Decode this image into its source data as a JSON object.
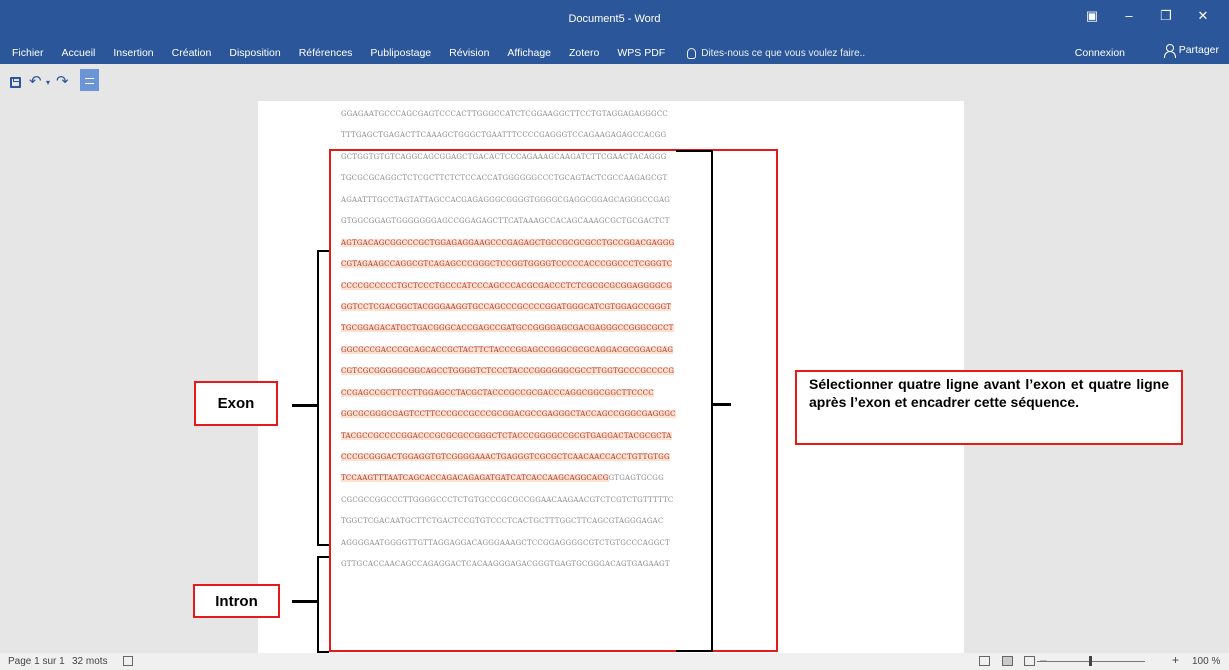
{
  "window": {
    "title": "Document5 - Word",
    "controls": [
      "ribbon-display",
      "minimize",
      "restore",
      "close"
    ]
  },
  "ribbon": {
    "tabs": [
      "Fichier",
      "Accueil",
      "Insertion",
      "Création",
      "Disposition",
      "Références",
      "Publipostage",
      "Révision",
      "Affichage",
      "Zotero",
      "WPS PDF"
    ],
    "tell_me": "Dites-nous ce que vous voulez faire..",
    "connexion": "Connexion",
    "partager": "Partager"
  },
  "quick_access": {
    "icons": [
      "save-icon",
      "undo-icon",
      "redo-icon",
      "touch-mode-icon"
    ]
  },
  "document": {
    "sequence_lines": [
      {
        "text": "GGAGAATGCCCAGCGAGTCCCACTTGGGCCATCTCGGAAGGCTTCCTGTAGGAGAGGGCC",
        "exon": false
      },
      {
        "text": "TTTGAGCTGAGACTTCAAAGCTGGGCTGAATTTCCCCGAGGGTCCAGAAGAGAGCCACGG",
        "exon": false
      },
      {
        "text": "GCTGGTGTGTCAGGCAGCGGAGCTGACACTCCCAGAAAGCAAGATCTTCGAACTACAGGG",
        "exon": false
      },
      {
        "text": "TGCGCGCAGGCTCTCGCTTCTCTCCACCATGGGGGGCCCTGCAGTACTCGCCAAGAGCGT",
        "exon": false
      },
      {
        "text": "AGAATTTGCCTAGTATTAGCCACGAGAGGGCGGGGTGGGGCGAGGCGGAGCAGGGCCGAG",
        "exon": false
      },
      {
        "text": "GTGGCGGAGTGGGGGGGAGCCGGAGAGCTTCATAAAGCCACAGCAAAGCGCTGCGACTCT",
        "exon": false
      },
      {
        "text": "AGTGACAGCGGCCCGCTGGAGAGGAAGCCCGAGAGCTGCCGCGCGCCTGCCGGACGAGGG",
        "exon": true
      },
      {
        "text": "CGTAGAAGCCAGGCGTCAGAGCCCGGGCTCCGGTGGGGTCCCCCACCCGGCCCTCGGGTC",
        "exon": true
      },
      {
        "text": "CCCCGCCCCCTGCTCCCTGCCCATCCCAGCCCACGCGACCCTCTCGCGCGCGGAGGGGCG",
        "exon": true
      },
      {
        "text": "GGTCCTCGACGGCTACGGGAAGGTGCCAGCCCGCCCCGGATGGGCATCGTGGAGCCGGGT",
        "exon": true
      },
      {
        "text": "TGCGGAGACATGCTGACGGGCACCGAGCCGATGCCGGGGAGCGACGAGGGCCGGGCGCCT",
        "exon": true
      },
      {
        "text": "GGCGCCGACCCGCAGCACCGCTACTTCTACCCGGAGCCGGGCGCGCAGGACGCGGACGAG",
        "exon": true
      },
      {
        "text": "CGTCGCGGGGGCGGCAGCCTGGGGTCTCCCTACCCGGGGGGCGCCTTGGTGCCCGCCCCG",
        "exon": true
      },
      {
        "text": "CCGAGCCGCTTCCTTGGAGCCTACGCTACCCGCCGCGACCCAGGCGGCGGCTTCCCC",
        "exon": true
      },
      {
        "text": "GGCGCGGGCGAGTCCTTCCCGCCGCCCGCGGACGCCGAGGGCTACCAGCCGGGCGAGGGC",
        "exon": true
      },
      {
        "text": "TACGCCGCCCCGGACCCGCGCGCCGGGCTCTACCCGGGGCCGCGTGAGGACTACGCGCTA",
        "exon": true
      },
      {
        "text": "CCCGCGGGACTGGAGGTGTCGGGGAAACTGAGGGTCGCGCTCAACAACCACCTGTTGTGG",
        "exon": true
      },
      {
        "text": "TCCAAGTTTAATCAGCACCAGACAGAGATGATCATCACCAAGCAGGCACGGTGAGTGCGG",
        "exon": true,
        "exon_part": "TCCAAGTTTAATCAGCACCAGACAGAGATGATCATCACCAAGCAGGCACG",
        "intron_part": "GTGAGTGCGG"
      },
      {
        "text": "CGCGCCGGCCCTTGGGGCCCTCTGTGCCCGCGCCGGAACAAGAACGTCTCGTCTGTTTTTC",
        "exon": false
      },
      {
        "text": "TGGCTCGACAATGCTTCTGACTCCGTGTCCCTCACTGCTTTGGCTTCAGCGTAGGGAGAC",
        "exon": false
      },
      {
        "text": "AGGGGAATGGGGTTGTTAGGAGGACAGGGAAAGCTCCGGAGGGGCGTCTGTGCCCAGGCT",
        "exon": false
      },
      {
        "text": "GTTGCACCAACAGCCAGAGGACTCACAAGGGAGACGGGTGAGTGCGGGACAGTGAGAAGT",
        "exon": false
      }
    ]
  },
  "annotations": {
    "exon_label": "Exon",
    "intron_label": "Intron",
    "instruction": "Sélectionner quatre ligne  avant l’exon et quatre ligne après l’exon et encadrer cette séquence."
  },
  "colors": {
    "ribbon_blue": "#2b579a",
    "annotation_red": "#e31b1b",
    "exon_text": "#b03a2e",
    "exon_highlight": "#fde0cf"
  },
  "statusbar": {
    "page": "Page 1 sur 1",
    "words": "32 mots",
    "zoom": "100 %"
  }
}
